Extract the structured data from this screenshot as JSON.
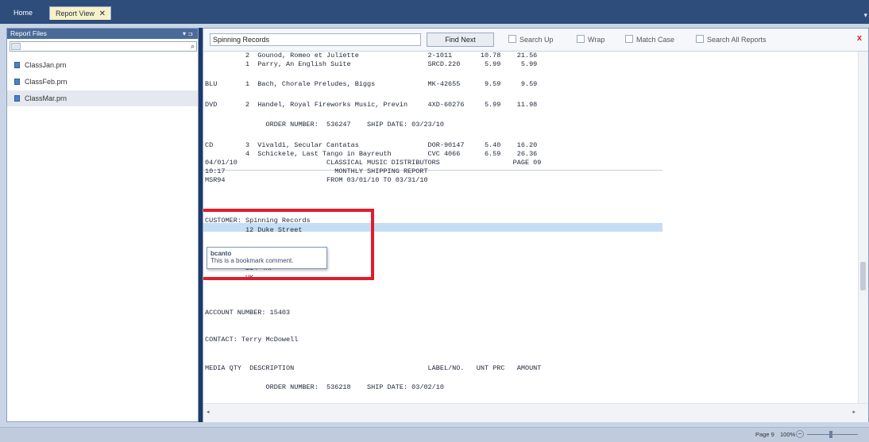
{
  "tabs": {
    "home": "Home",
    "report_view": "Report View",
    "close_glyph": "✕"
  },
  "left_panel": {
    "title": "Report Files",
    "pin_glyph": "▾ ⊐",
    "files": [
      {
        "label": "ClassJan.prn",
        "selected": false
      },
      {
        "label": "ClassFeb.prn",
        "selected": false
      },
      {
        "label": "ClassMar.prn",
        "selected": true
      }
    ]
  },
  "toolbar": {
    "search_value": "Spinning Records",
    "find_next": "Find Next",
    "search_up": "Search Up",
    "wrap": "Wrap",
    "match_case": "Match Case",
    "search_all": "Search All Reports",
    "close": "x"
  },
  "report_lines": [
    "          2  Gounod, Romeo et Juliette                 2-1011       10.78    21.56",
    "          1  Parry, An English Suite                   SRCD.220      5.99     5.99",
    "",
    "BLU       1  Bach, Chorale Preludes, Biggs             MK-42655      9.59     9.59",
    "",
    "DVD       2  Handel, Royal Fireworks Music, Previn     4XD-60276     5.99    11.98",
    "",
    "               ORDER NUMBER:  536247    SHIP DATE: 03/23/10",
    "",
    "CD        3  Vivaldi, Secular Cantatas                 DOR-90147     5.40    16.20",
    "          4  Schickele, Last Tango in Bayreuth         CVC 4066      6.59    26.36",
    "04/01/10                      CLASSICAL MUSIC DISTRIBUTORS                  PAGE 09",
    "10:17                           MONTHLY SHIPPING REPORT",
    "MSR94                         FROM 03/01/10 TO 03/31/10",
    "",
    "",
    "CUSTOMER: Spinning Records",
    "          12 Duke Street",
    "",
    "",
    "",
    "          BS4 4RP",
    "          UK",
    "",
    "",
    "ACCOUNT NUMBER: 15403",
    "",
    "CONTACT: Terry McDowell",
    "",
    "",
    "MEDIA QTY  DESCRIPTION                                 LABEL/NO.   UNT PRC   AMOUNT",
    "",
    "               ORDER NUMBER:  536218    SHIP DATE: 03/02/10"
  ],
  "tooltip": {
    "title": "bcanto",
    "text": "This is a bookmark comment."
  },
  "status": {
    "page": "Page 9",
    "zoom": "100%",
    "zoom_minus": "−"
  },
  "colors": {
    "highlight": "#c6def4",
    "redbox": "#e21b2c",
    "topbar": "#2e4d7b"
  }
}
